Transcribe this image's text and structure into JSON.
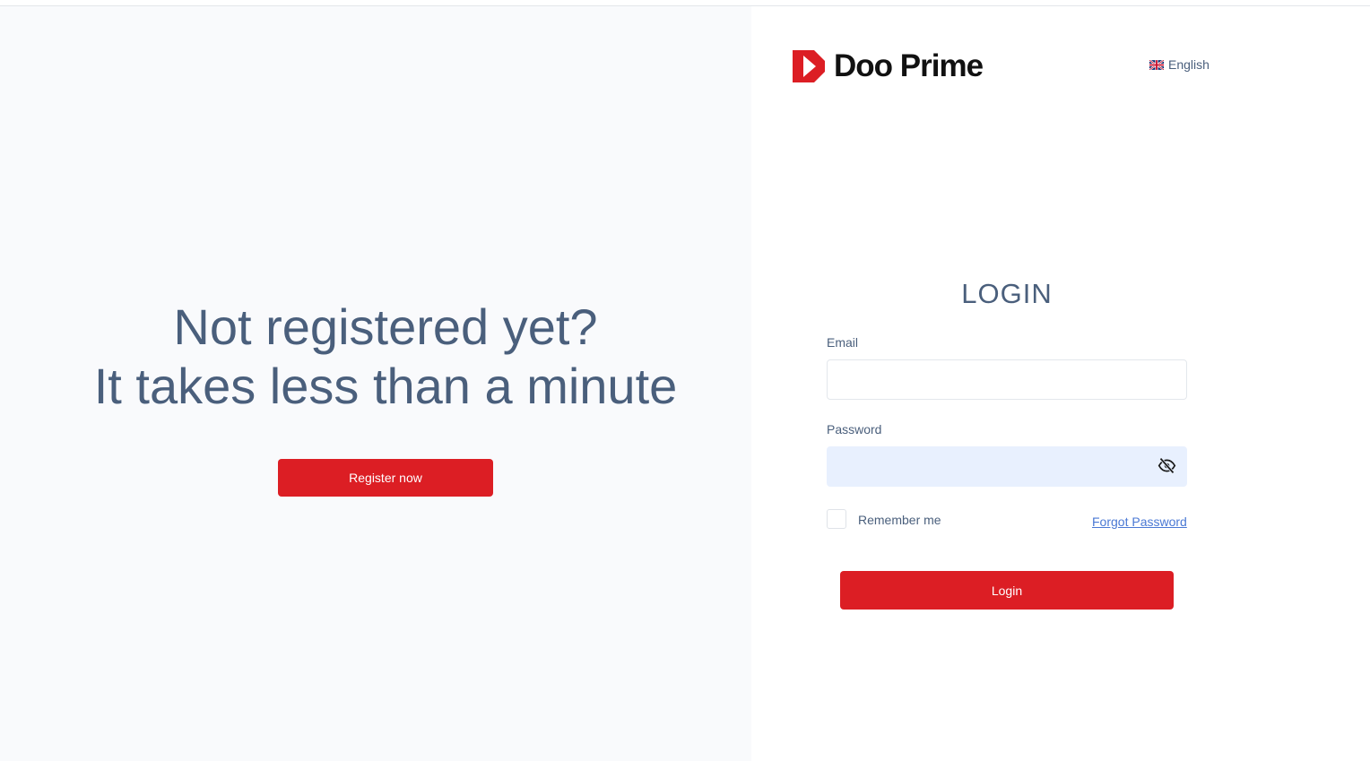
{
  "register_panel": {
    "headline_line1": "Not registered yet?",
    "headline_line2": "It takes less than a minute",
    "register_button": "Register now"
  },
  "header": {
    "brand_name": "Doo Prime",
    "language": "English",
    "language_flag_icon": "uk-flag-icon"
  },
  "login_form": {
    "title": "LOGIN",
    "email_label": "Email",
    "email_value": "",
    "password_label": "Password",
    "password_value": "",
    "password_toggle_icon": "eye-slash-icon",
    "remember_label": "Remember me",
    "forgot_link": "Forgot Password",
    "login_button": "Login"
  },
  "colors": {
    "accent_red": "#dc1e24",
    "heading_slate": "#4a5f7c",
    "link_blue": "#4a78d4",
    "autofill_blue": "#e8f0fe"
  }
}
